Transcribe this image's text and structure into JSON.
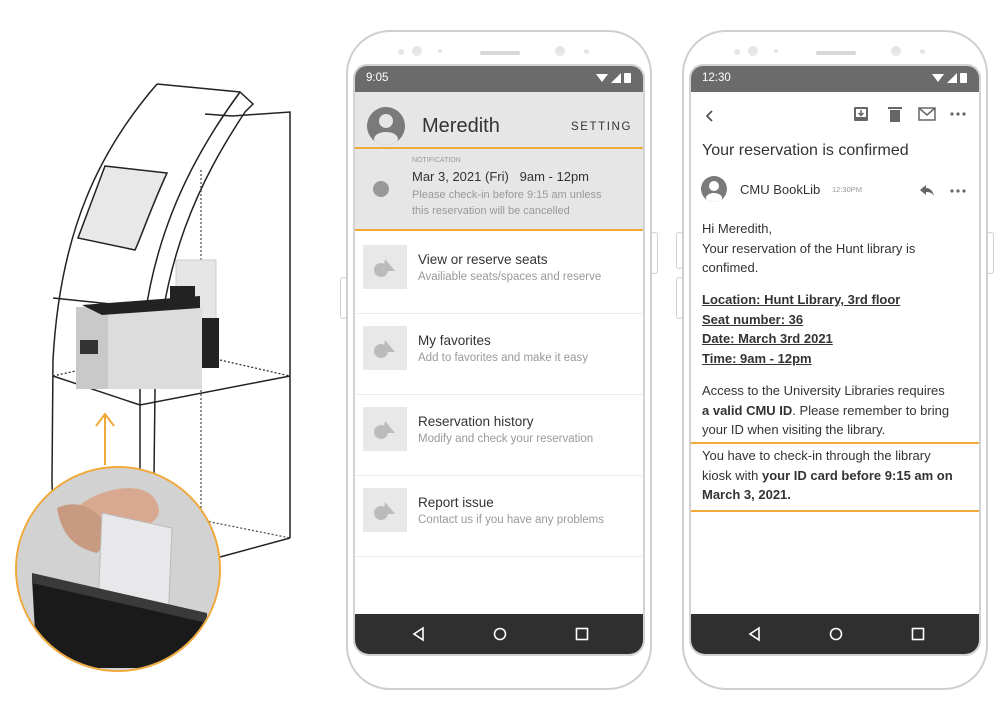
{
  "illustration": {
    "description": "Library kiosk with card reader",
    "accent_color": "#f0a93a"
  },
  "phone_app": {
    "status_time": "9:05",
    "user_name": "Meredith",
    "setting_label": "SETTING",
    "notification": {
      "label": "NOTIFICATION",
      "title": "Mar 3, 2021 (Fri)   9am - 12pm",
      "message_line1": "Please check-in before 9:15 am unless",
      "message_line2": "this reservation will be cancelled"
    },
    "menu_items": [
      {
        "title": "View or reserve seats",
        "subtitle": "Availiable seats/spaces and reserve",
        "icon": "shapes-icon"
      },
      {
        "title": "My favorites",
        "subtitle": "Add to favorites and make it easy",
        "icon": "shapes-icon"
      },
      {
        "title": "Reservation history",
        "subtitle": "Modify and check your reservation",
        "icon": "shapes-icon"
      },
      {
        "title": "Report issue",
        "subtitle": "Contact us if you have any problems",
        "icon": "shapes-icon"
      }
    ]
  },
  "phone_email": {
    "status_time": "12:30",
    "subject": "Your reservation is confirmed",
    "sender": "CMU BookLib",
    "sent_time": "12:30PM",
    "greeting": "Hi Meredith,",
    "intro_line1": "Your reservation of the Hunt library is",
    "intro_line2": "confimed.",
    "details": {
      "location": "Location: Hunt Library, 3rd floor",
      "seat": "Seat number: 36",
      "date": "Date: March 3rd 2021",
      "time": "Time: 9am - 12pm"
    },
    "access": {
      "line1": "Access to the University Libraries requires",
      "bold1": "a valid CMU ID",
      "line2_rest": ". Please remember to bring",
      "line3": "your ID when visiting the library."
    },
    "checkin": {
      "line1": "You have to check-in through the library",
      "line2_plain": "kiosk with ",
      "line2_bold": "your ID card before 9:15 am on",
      "line3_bold": "March 3, 2021."
    }
  }
}
